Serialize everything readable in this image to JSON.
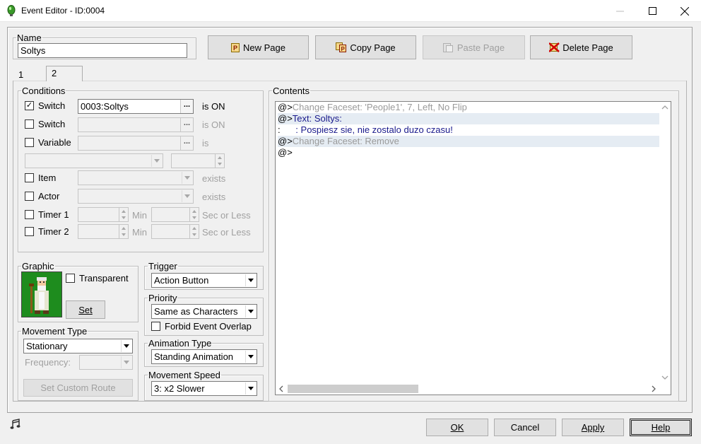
{
  "window": {
    "title": "Event Editor - ID:0004"
  },
  "name_group": {
    "legend": "Name",
    "value": "Soltys"
  },
  "toolbar": {
    "new_page": "New Page",
    "copy_page": "Copy Page",
    "paste_page": "Paste Page",
    "delete_page": "Delete Page"
  },
  "tabs": [
    {
      "label": "1"
    },
    {
      "label": "2",
      "selected": true
    }
  ],
  "conditions": {
    "legend": "Conditions",
    "switch1": {
      "label": "Switch",
      "checked": true,
      "value": "0003:Soltys",
      "suffix": "is ON"
    },
    "switch2": {
      "label": "Switch",
      "checked": false,
      "value": "",
      "suffix": "is ON"
    },
    "variable": {
      "label": "Variable",
      "checked": false,
      "value": "",
      "suffix": "is"
    },
    "item": {
      "label": "Item",
      "checked": false,
      "suffix": "exists"
    },
    "actor": {
      "label": "Actor",
      "checked": false,
      "suffix": "exists"
    },
    "timer1": {
      "label": "Timer 1",
      "checked": false,
      "min_label": "Min",
      "sec_label": "Sec or Less"
    },
    "timer2": {
      "label": "Timer 2",
      "checked": false,
      "min_label": "Min",
      "sec_label": "Sec or Less"
    }
  },
  "graphic": {
    "legend": "Graphic",
    "transparent_label": "Transparent",
    "transparent_checked": false,
    "set_button": "Set"
  },
  "trigger": {
    "legend": "Trigger",
    "value": "Action Button"
  },
  "priority": {
    "legend": "Priority",
    "value": "Same as Characters",
    "forbid_label": "Forbid Event Overlap",
    "forbid_checked": false
  },
  "animation": {
    "legend": "Animation Type",
    "value": "Standing Animation"
  },
  "movement_type": {
    "legend": "Movement Type",
    "value": "Stationary",
    "frequency_label": "Frequency:",
    "custom_route_button": "Set Custom Route"
  },
  "movement_speed": {
    "legend": "Movement Speed",
    "value": "3: x2 Slower"
  },
  "contents": {
    "legend": "Contents",
    "commands": [
      {
        "prefix": "@>",
        "text": "Change Faceset: 'People1', 7, Left, No Flip",
        "color": "#9a9a9a",
        "selected": false
      },
      {
        "prefix": "@>",
        "text": "Text: Soltys:",
        "color": "#1a1a8c",
        "selected": true
      },
      {
        "prefix": " :",
        "text": "      : Pospiesz sie, nie zostalo duzo czasu!",
        "color": "#1a1a8c",
        "selected": false
      },
      {
        "prefix": "@>",
        "text": "Change Faceset: Remove",
        "color": "#9a9a9a",
        "selected": true
      },
      {
        "prefix": "@>",
        "text": "",
        "color": "#000000",
        "selected": false
      }
    ]
  },
  "footer": {
    "ok": "OK",
    "cancel": "Cancel",
    "apply": "Apply",
    "help": "Help"
  },
  "icons": {
    "app": "green-orb-icon",
    "music": "music-note-icon",
    "new_page": "new-page-icon",
    "copy_page": "copy-page-icon",
    "paste_page": "paste-page-icon",
    "delete_page": "delete-page-icon"
  },
  "colors": {
    "selection_row": "#e5ecf3",
    "event_text": "#1a1a8c",
    "graphic_bg": "#1e8c1e"
  }
}
